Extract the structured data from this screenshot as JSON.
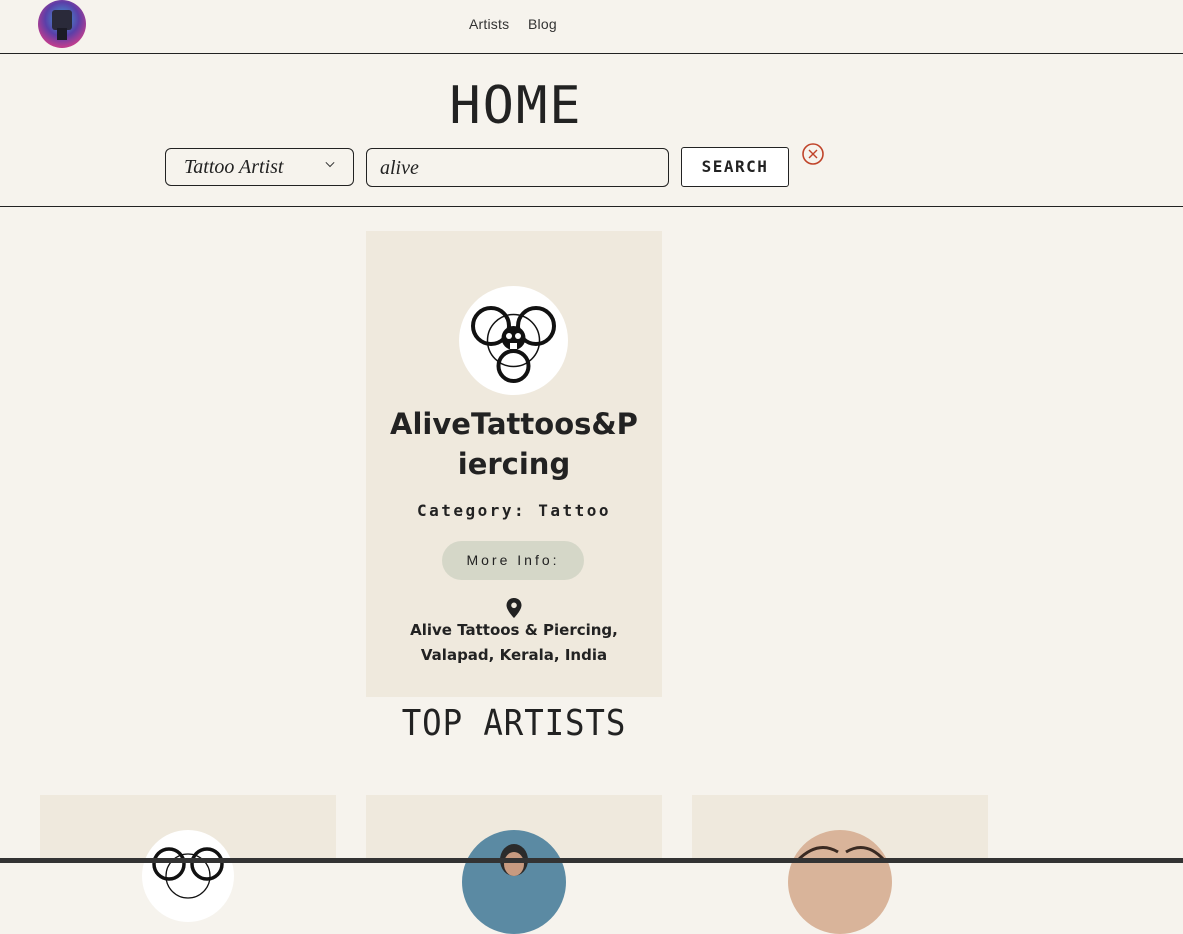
{
  "nav": {
    "artists": "Artists",
    "blog": "Blog"
  },
  "page": {
    "title": "HOME"
  },
  "search": {
    "category_selected": "Tattoo Artist",
    "query": "alive",
    "search_label": "SEARCH"
  },
  "result": {
    "name": "AliveTattoos&Piercing",
    "category": "Category: Tattoo",
    "more_info": "More Info:",
    "address": "Alive Tattoos & Piercing, Valapad, Kerala, India"
  },
  "section": {
    "top_artists": "TOP ARTISTS"
  },
  "colors": {
    "background": "#f6f3ed",
    "card": "#efe9dd",
    "button_pill": "#d5d7c8",
    "clear_icon": "#c0442a"
  },
  "icons": {
    "dropdown": "chevron-down-icon",
    "clear": "close-circle-icon",
    "location": "map-pin-icon"
  }
}
